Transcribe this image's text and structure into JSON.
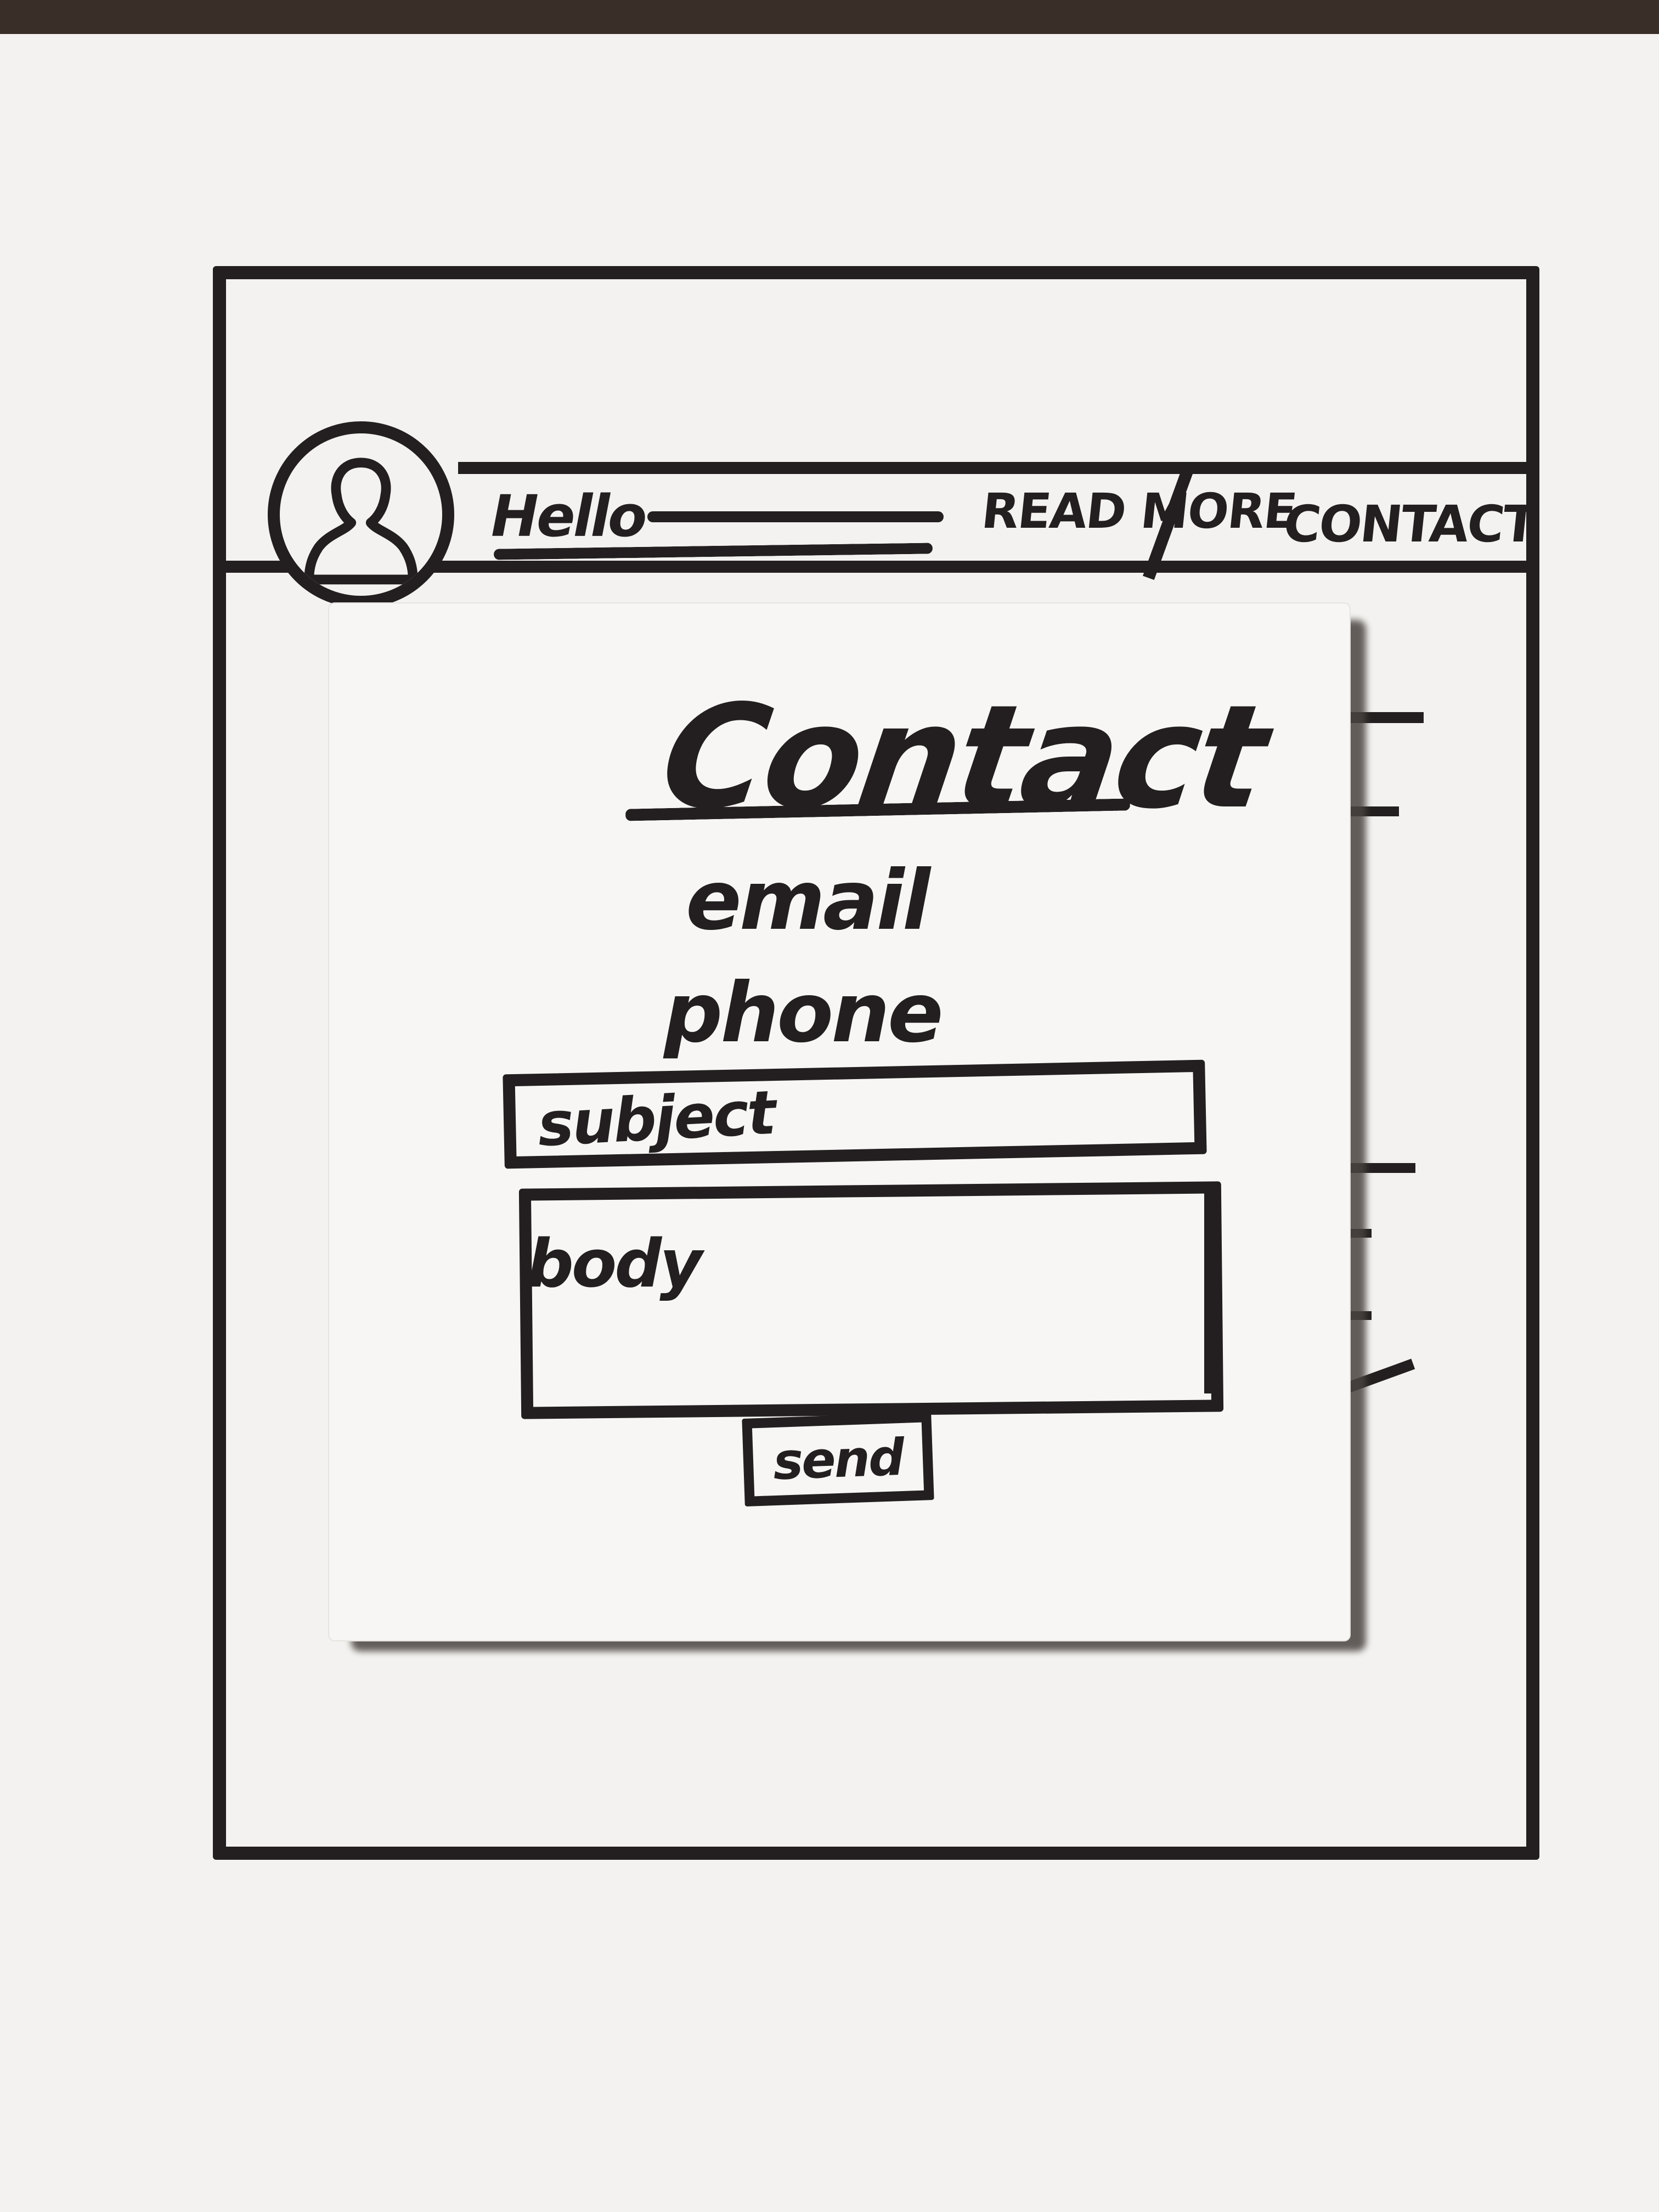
{
  "header": {
    "greeting": "Hello",
    "nav_links": [
      {
        "label": "READ MORE"
      },
      {
        "label": "CONTACT"
      }
    ],
    "avatar_icon": "user-avatar-icon"
  },
  "contact_modal": {
    "title": "Contact",
    "email_label": "email",
    "phone_label": "phone",
    "subject_label": "subject",
    "body_label": "body",
    "send_label": "send"
  },
  "colors": {
    "ink": "#231f20",
    "paper": "#f4f2f0",
    "note": "#f7f6f4"
  }
}
